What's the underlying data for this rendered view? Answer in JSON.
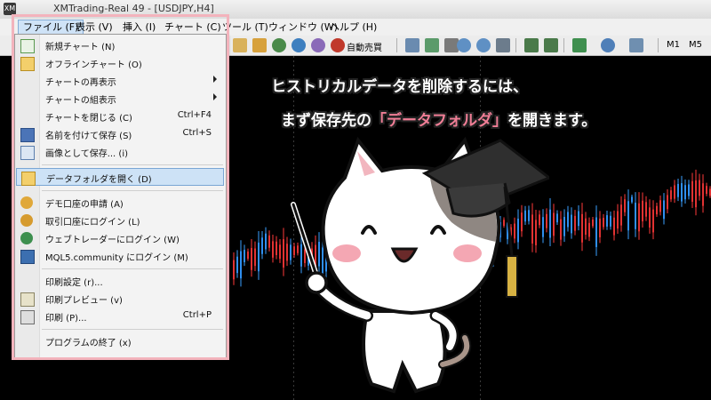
{
  "window": {
    "title": "XMTrading-Real 49 - [USDJPY,H4]"
  },
  "menubar": {
    "items": [
      {
        "label": "ファイル (F)"
      },
      {
        "label": "表示 (V)"
      },
      {
        "label": "挿入 (I)"
      },
      {
        "label": "チャート (C)"
      },
      {
        "label": "ツール (T)"
      },
      {
        "label": "ウィンドウ (W)"
      },
      {
        "label": "ヘルプ (H)"
      }
    ]
  },
  "toolbar": {
    "autotrade_label": "自動売買",
    "timeframe_m1": "M1",
    "timeframe_m5": "M5"
  },
  "file_menu": {
    "items": [
      {
        "label": "新規チャート (N)",
        "shortcut": "",
        "icon": "new-chart-icon"
      },
      {
        "label": "オフラインチャート (O)",
        "shortcut": "",
        "icon": "folder-icon"
      },
      {
        "label": "チャートの再表示",
        "shortcut": "",
        "icon": "",
        "submenu": true
      },
      {
        "label": "チャートの組表示",
        "shortcut": "",
        "icon": "",
        "submenu": true
      },
      {
        "label": "チャートを閉じる (C)",
        "shortcut": "Ctrl+F4",
        "icon": ""
      },
      {
        "label": "名前を付けて保存 (S)",
        "shortcut": "Ctrl+S",
        "icon": "save-icon"
      },
      {
        "label": "画像として保存... (i)",
        "shortcut": "",
        "icon": "image-save-icon"
      },
      {
        "label": "データフォルダを開く (D)",
        "shortcut": "",
        "icon": "folder-icon"
      },
      {
        "label": "デモ口座の申請 (A)",
        "shortcut": "",
        "icon": "demo-account-icon"
      },
      {
        "label": "取引口座にログイン (L)",
        "shortcut": "",
        "icon": "login-icon"
      },
      {
        "label": "ウェブトレーダーにログイン (W)",
        "shortcut": "",
        "icon": "web-trader-icon"
      },
      {
        "label": "MQL5.community にログイン (M)",
        "shortcut": "",
        "icon": "mql5-icon"
      },
      {
        "label": "印刷設定 (r)...",
        "shortcut": "",
        "icon": ""
      },
      {
        "label": "印刷プレビュー (v)",
        "shortcut": "",
        "icon": "print-preview-icon"
      },
      {
        "label": "印刷 (P)...",
        "shortcut": "Ctrl+P",
        "icon": "print-icon"
      },
      {
        "label": "プログラムの終了 (x)",
        "shortcut": "",
        "icon": ""
      }
    ]
  },
  "caption": {
    "line1": "ヒストリカルデータを削除するには、",
    "line2_prefix": "まず保存先の",
    "line2_highlight": "「データフォルダ」",
    "line2_suffix": "を開きます。"
  },
  "colors": {
    "highlight_frame": "#f3b3bc",
    "caption_highlight": "#f07e96",
    "menu_selection": "#cde2f6"
  }
}
